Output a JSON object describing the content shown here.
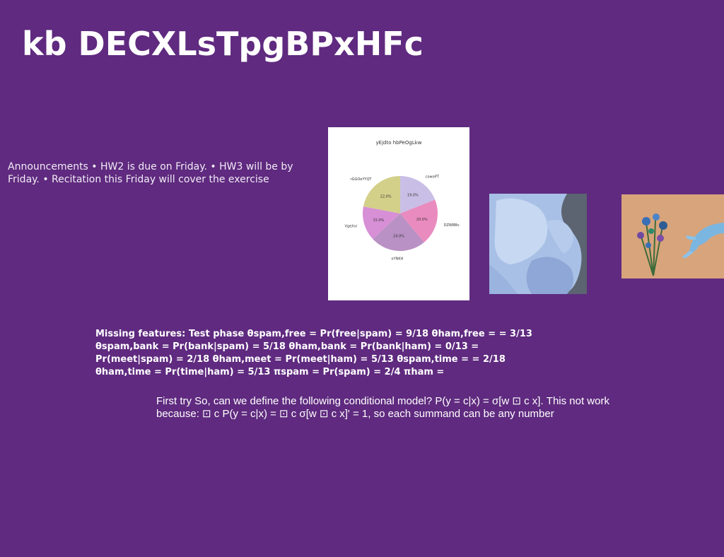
{
  "slide": {
    "title": "kb DECXLsTpgBPxHFc",
    "announcements": "Announcements • HW2 is due on Friday. • HW3 will be by Friday. • Recitation this Friday will cover the exercise",
    "missing_features": "Missing features: Test phase θspam,free = Pr(free|spam) = 9/18 θham,free = = 3/13 θspam,bank = Pr(bank|spam) = 5/18 θham,bank = Pr(bank|ham) = 0/13 = Pr(meet|spam) = 2/18 θham,meet = Pr(meet|ham) = 5/13 θspam,time = = 2/18 θham,time = Pr(time|ham) = 5/13 πspam = Pr(spam) = 2/4 πham =",
    "first_try": "First try So, can we define the following conditional model? P(y = c|x) = σ[w ⊡ c x]. This not work because: ⊡ c P(y = c|x) = ⊡ c σ[w ⊡ c x]' = 1, so each summand can be any number"
  },
  "chart_data": {
    "type": "pie",
    "title": "yEjdto hbPeOgLkw",
    "categories": [
      "cowoPT",
      "DZWBBv",
      "oYNKH",
      "VgeXvi",
      "rGGOeYYQT"
    ],
    "values": [
      19.0,
      20.0,
      24.0,
      15.0,
      22.0
    ],
    "labels": [
      "19.0%",
      "20.0%",
      "24.0%",
      "15.0%",
      "22.0%"
    ],
    "colors": [
      "#c9bfe6",
      "#e98bbf",
      "#b991c4",
      "#d78fd6",
      "#d3d08a"
    ],
    "start_angle_deg": 90,
    "direction": "clockwise"
  },
  "images": {
    "sculpture": "white-sculpture-photo",
    "flowers": "hand-with-flowers-photo"
  }
}
